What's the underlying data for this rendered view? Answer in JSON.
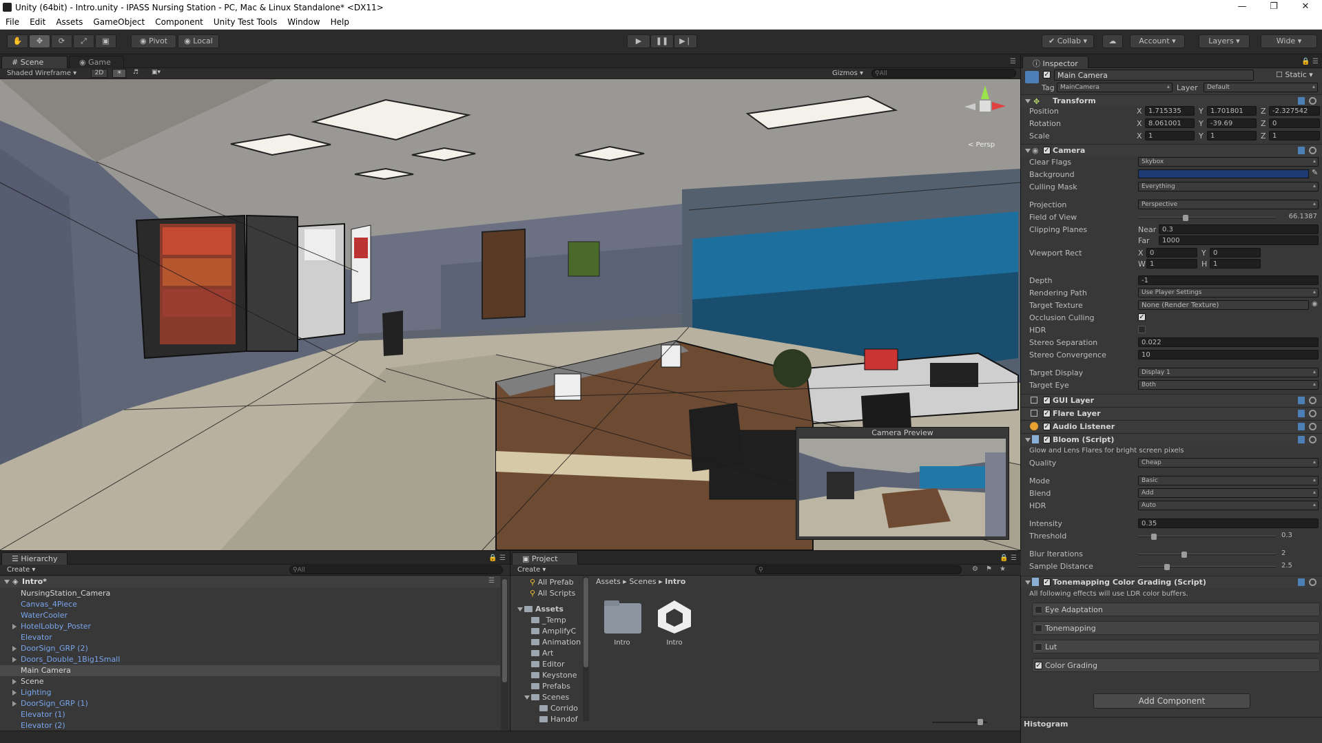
{
  "window": {
    "title": "Unity (64bit) - Intro.unity - IPASS Nursing Station - PC, Mac & Linux Standalone* <DX11>"
  },
  "menu": [
    "File",
    "Edit",
    "Assets",
    "GameObject",
    "Component",
    "Unity Test Tools",
    "Window",
    "Help"
  ],
  "toolbar": {
    "pivot": "Pivot",
    "local": "Local",
    "collab": "Collab",
    "account": "Account",
    "layers": "Layers",
    "layout": "Wide"
  },
  "scene": {
    "tab_scene": "Scene",
    "tab_game": "Game",
    "draw_mode": "Shaded Wireframe",
    "mode_2d": "2D",
    "gizmos": "Gizmos",
    "search_placeholder": "All",
    "persp_label": "< Persp",
    "camera_preview": "Camera Preview"
  },
  "inspector": {
    "tab": "Inspector",
    "object_name": "Main Camera",
    "static": "Static",
    "tag_label": "Tag",
    "tag": "MainCamera",
    "layer_label": "Layer",
    "layer": "Default",
    "transform": {
      "name": "Transform",
      "position_label": "Position",
      "rotation_label": "Rotation",
      "scale_label": "Scale",
      "position": {
        "x": "1.715335",
        "y": "1.701801",
        "z": "-2.327542"
      },
      "rotation": {
        "x": "8.061001",
        "y": "-39.69",
        "z": "0"
      },
      "scale": {
        "x": "1",
        "y": "1",
        "z": "1"
      }
    },
    "camera": {
      "name": "Camera",
      "clear_flags_label": "Clear Flags",
      "clear_flags": "Skybox",
      "background_label": "Background",
      "culling_mask_label": "Culling Mask",
      "culling_mask": "Everything",
      "projection_label": "Projection",
      "projection": "Perspective",
      "fov_label": "Field of View",
      "fov": "66.1387",
      "fov_fraction": 0.34,
      "clipping_label": "Clipping Planes",
      "near_label": "Near",
      "near": "0.3",
      "far_label": "Far",
      "far": "1000",
      "viewport_label": "Viewport Rect",
      "vx": "0",
      "vy": "0",
      "vw": "1",
      "vh": "1",
      "depth_label": "Depth",
      "depth": "-1",
      "rendering_path_label": "Rendering Path",
      "rendering_path": "Use Player Settings",
      "target_texture_label": "Target Texture",
      "target_texture": "None (Render Texture)",
      "occlusion_label": "Occlusion Culling",
      "hdr_label": "HDR",
      "stereo_sep_label": "Stereo Separation",
      "stereo_sep": "0.022",
      "stereo_conv_label": "Stereo Convergence",
      "stereo_conv": "10",
      "target_display_label": "Target Display",
      "target_display": "Display 1",
      "target_eye_label": "Target Eye",
      "target_eye": "Both"
    },
    "gui_layer": "GUI Layer",
    "flare_layer": "Flare Layer",
    "audio_listener": "Audio Listener",
    "bloom": {
      "name": "Bloom (Script)",
      "desc": "Glow and Lens Flares for bright screen pixels",
      "quality_label": "Quality",
      "quality": "Cheap",
      "mode_label": "Mode",
      "mode": "Basic",
      "blend_label": "Blend",
      "blend": "Add",
      "hdr_label": "HDR",
      "hdr": "Auto",
      "intensity_label": "Intensity",
      "intensity": "0.35",
      "threshold_label": "Threshold",
      "threshold": "0.3",
      "threshold_fraction": 0.1,
      "blur_label": "Blur Iterations",
      "blur": "2",
      "blur_fraction": 0.33,
      "sample_label": "Sample Distance",
      "sample": "2.5",
      "sample_fraction": 0.2
    },
    "tonemapping": {
      "name": "Tonemapping Color Grading (Script)",
      "desc": "All following effects will use LDR color buffers.",
      "items": [
        "Eye Adaptation",
        "Tonemapping",
        "Lut",
        "Color Grading"
      ]
    },
    "add_component": "Add Component",
    "histogram": "Histogram"
  },
  "hierarchy": {
    "tab": "Hierarchy",
    "create": "Create",
    "search_placeholder": "All",
    "scene_name": "Intro*",
    "items": [
      "NursingStation_Camera",
      "Canvas_4Piece",
      "WaterCooler",
      "HotelLobby_Poster",
      "Elevator",
      "DoorSign_GRP (2)",
      "Doors_Double_1Big1Small",
      "Main Camera",
      "Scene",
      "Lighting",
      "DoorSign_GRP (1)",
      "Elevator (1)",
      "Elevator (2)"
    ]
  },
  "project": {
    "tab": "Project",
    "create": "Create",
    "favorites": [
      "All Prefab",
      "All Scripts"
    ],
    "assets_root": "Assets",
    "folders": [
      "_Temp",
      "AmplifyC",
      "Animation",
      "Art",
      "Editor",
      "Keystone",
      "Prefabs",
      "Scenes"
    ],
    "subfolders": [
      "Corrido",
      "Handof"
    ],
    "breadcrumb": [
      "Assets",
      "Scenes",
      "Intro"
    ],
    "grid_items": [
      "Intro",
      "Intro"
    ]
  }
}
